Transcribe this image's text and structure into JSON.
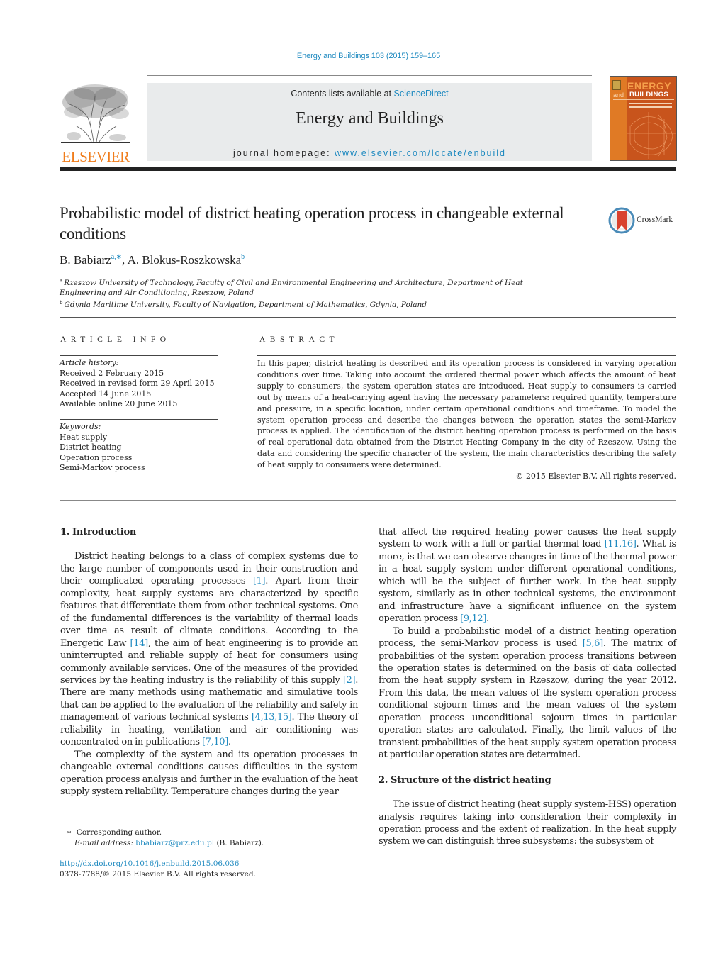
{
  "header": {
    "citation": "Energy and Buildings 103 (2015) 159–165",
    "contents_prefix": "Contents lists available at ",
    "contents_link": "ScienceDirect",
    "journal_name": "Energy and Buildings",
    "homepage_prefix": "journal homepage: ",
    "homepage_link": "www.elsevier.com/locate/enbuild",
    "publisher_logo_text": "ELSEVIER",
    "cover": {
      "title_line1": "ENERGY",
      "title_and": "and",
      "title_line2": "BUILDINGS"
    },
    "crossmark_label": "CrossMark"
  },
  "article": {
    "title": "Probabilistic model of district heating operation process in changeable external conditions",
    "authors": [
      {
        "name": "B. Babiarz",
        "marks": "a,∗"
      },
      {
        "name": "A. Blokus-Roszkowska",
        "marks": "b"
      }
    ],
    "author_separator": ", ",
    "affiliations": [
      {
        "mark": "a",
        "text": "Rzeszow University of Technology, Faculty of Civil and Environmental Engineering and Architecture, Department of Heat Engineering and Air Conditioning, Rzeszow, Poland"
      },
      {
        "mark": "b",
        "text": "Gdynia Maritime University, Faculty of Navigation, Department of Mathematics, Gdynia, Poland"
      }
    ]
  },
  "article_info": {
    "heading": "ARTICLE INFO",
    "history_label": "Article history:",
    "history": [
      "Received 2 February 2015",
      "Received in revised form 29 April 2015",
      "Accepted 14 June 2015",
      "Available online 20 June 2015"
    ],
    "keywords_label": "Keywords:",
    "keywords": [
      "Heat supply",
      "District heating",
      "Operation process",
      "Semi-Markov process"
    ]
  },
  "abstract": {
    "heading": "ABSTRACT",
    "text": "In this paper, district heating is described and its operation process is considered in varying operation conditions over time. Taking into account the ordered thermal power which affects the amount of heat supply to consumers, the system operation states are introduced. Heat supply to consumers is carried out by means of a heat-carrying agent having the necessary parameters: required quantity, temperature and pressure, in a specific location, under certain operational conditions and timeframe. To model the system operation process and describe the changes between the operation states the semi-Markov process is applied. The identification of the district heating operation process is performed on the basis of real operational data obtained from the District Heating Company in the city of Rzeszow. Using the data and considering the specific character of the system, the main characteristics describing the safety of heat supply to consumers were determined.",
    "copyright": "© 2015 Elsevier B.V. All rights reserved."
  },
  "body": {
    "section1": {
      "heading": "1.  Introduction",
      "p1": [
        {
          "t": "District heating belongs to a class of complex systems due to the large number of components used in their construction and their complicated operating processes "
        },
        {
          "ref": "[1]"
        },
        {
          "t": ". Apart from their complexity, heat supply systems are characterized by specific features that differentiate them from other technical systems. One of the fundamental differences is the variability of thermal loads over time as result of climate conditions. According to the Energetic Law "
        },
        {
          "ref": "[14]"
        },
        {
          "t": ", the aim of heat engineering is to provide an uninterrupted and reliable supply of heat for consumers using commonly available services. One of the measures of the provided services by the heating industry is the reliability of this supply "
        },
        {
          "ref": "[2]"
        },
        {
          "t": ". There are many methods using mathematic and simulative tools that can be applied to the evaluation of the reliability and safety in management of various technical systems "
        },
        {
          "ref": "[4,13,15]"
        },
        {
          "t": ". The theory of reliability in heating, ventilation and air conditioning was concentrated on in publications "
        },
        {
          "ref": "[7,10]"
        },
        {
          "t": "."
        }
      ],
      "p2": [
        {
          "t": "The complexity of the system and its operation processes in changeable external conditions causes difficulties in the system operation process analysis and further in the evaluation of the heat supply system reliability. Temperature changes during the year that affect the required heating power causes the heat supply system to work with a full or partial thermal load "
        },
        {
          "ref": "[11,16]"
        },
        {
          "t": ". What is more, is that we can observe changes in time of the thermal power in a heat supply system under different operational conditions, which will be the subject of further work. In the heat supply system, similarly as in other technical systems, the environment and infrastructure have a significant influence on the system operation process "
        },
        {
          "ref": "[9,12]"
        },
        {
          "t": "."
        }
      ],
      "p3": [
        {
          "t": "To build a probabilistic model of a district heating operation process, the semi-Markov process is used "
        },
        {
          "ref": "[5,6]"
        },
        {
          "t": ". The matrix of probabilities of the system operation process transitions between the operation states is determined on the basis of data collected from the heat supply system in Rzeszow, during the year 2012. From this data, the mean values of the system operation process conditional sojourn times and the mean values of the system operation process unconditional sojourn times in particular operation states are calculated. Finally, the limit values of the transient probabilities of the heat supply system operation process at particular operation states are determined."
        }
      ]
    },
    "section2": {
      "heading": "2.  Structure of the district heating",
      "p1": [
        {
          "t": "The issue of district heating (heat supply system-HSS) operation analysis requires taking into consideration their complexity in operation process and the extent of realization. In the heat supply system we can distinguish three subsystems: the subsystem of"
        }
      ]
    }
  },
  "footnotes": {
    "star": "∗",
    "corresponding": "Corresponding author.",
    "email_label": "E-mail address: ",
    "email": "bbabiarz@prz.edu.pl",
    "email_suffix": " (B. Babiarz).",
    "doi": "http://dx.doi.org/10.1016/j.enbuild.2015.06.036",
    "issn_copyright": "0378-7788/© 2015 Elsevier B.V. All rights reserved."
  },
  "colors": {
    "link": "#1f8ac0",
    "elsevier_orange": "#f07d1c",
    "masthead_bg": "#e9ebec",
    "cover_bg": "#c8541c"
  }
}
